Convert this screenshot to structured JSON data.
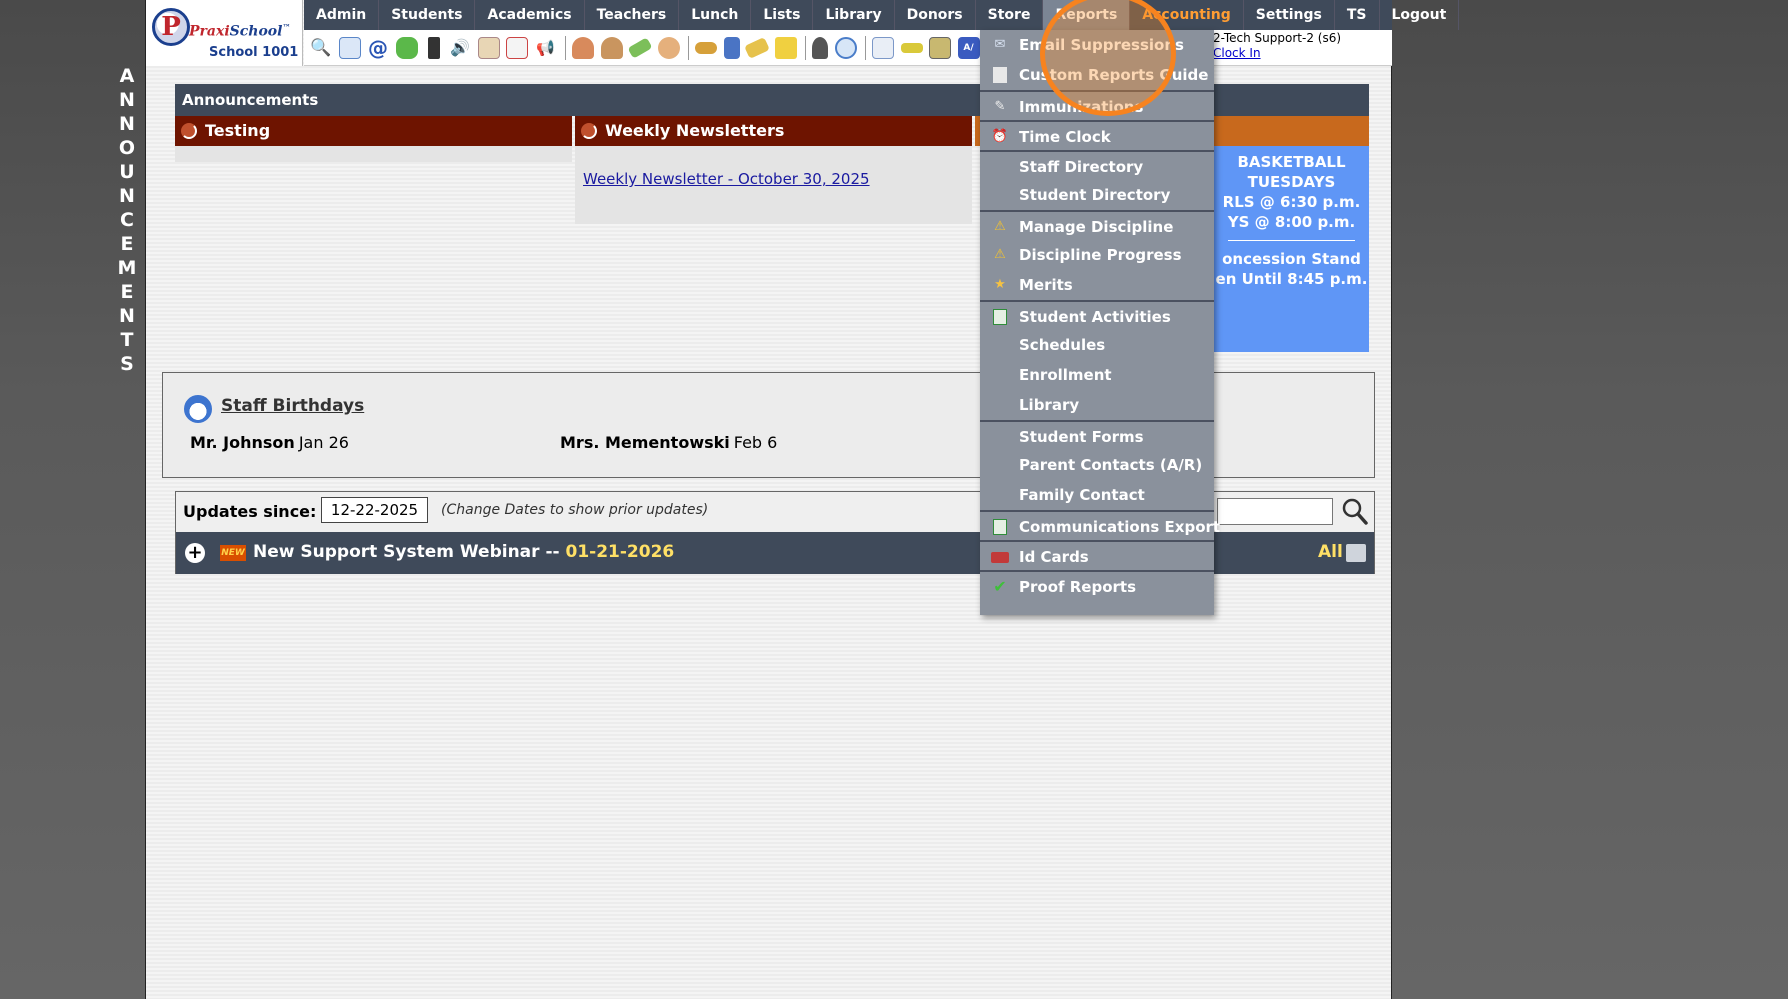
{
  "vertical_label": [
    "A",
    "N",
    "N",
    "O",
    "U",
    "N",
    "C",
    "E",
    "M",
    "E",
    "N",
    "T",
    "S"
  ],
  "logo": {
    "letter": "P",
    "brand_part1": "Praxi",
    "brand_part2": "School",
    "tm": "™",
    "school": "School 1001"
  },
  "nav": {
    "items": [
      "Admin",
      "Students",
      "Academics",
      "Teachers",
      "Lunch",
      "Lists",
      "Library",
      "Donors",
      "Store",
      "Reports",
      "Accounting",
      "Settings",
      "TS",
      "Logout"
    ]
  },
  "user": {
    "name": "2-Tech Support-2 (s6)",
    "clock_in": "Clock In"
  },
  "announcements": {
    "header": "Announcements",
    "columns": [
      {
        "title": "Testing",
        "color": "#6e1400"
      },
      {
        "title": "Weekly Newsletters",
        "color": "#6e1400",
        "link": "Weekly Newsletter - October 30, 2025"
      }
    ],
    "basketball": {
      "lines": [
        "BASKETBALL",
        "TUESDAYS",
        "RLS @ 6:30 p.m.",
        "YS  @ 8:00 p.m."
      ],
      "lines2": [
        "oncession Stand",
        "en Until 8:45 p.m."
      ]
    }
  },
  "birthdays": {
    "title": "Staff Birthdays",
    "entries": [
      {
        "name": "Mr. Johnson",
        "date": "Jan 26"
      },
      {
        "name": "Mrs. Mementowski",
        "date": "Feb 6"
      }
    ]
  },
  "updates": {
    "label": "Updates since:",
    "date": "12-22-2025",
    "note": "(Change Dates to show prior updates)",
    "item_badge": "NEW",
    "item_title": "New Support System Webinar -- ",
    "item_date": "01-21-2026",
    "all_label": "All"
  },
  "reports_menu": [
    {
      "label": "Email Suppressions",
      "icon": "envelope-icon",
      "sep": false
    },
    {
      "label": "Custom Reports Guide",
      "icon": "document-icon",
      "sep": false
    },
    {
      "label": "Immunizations",
      "icon": "syringe-icon",
      "sep": true
    },
    {
      "label": "Time Clock",
      "icon": "alarm-clock-icon",
      "sep": true
    },
    {
      "label": "Staff Directory",
      "icon": "",
      "sep": true
    },
    {
      "label": "Student Directory",
      "icon": "",
      "sep": false
    },
    {
      "label": "Manage Discipline",
      "icon": "warning-icon",
      "sep": true
    },
    {
      "label": "Discipline Progress",
      "icon": "warning-icon",
      "sep": false
    },
    {
      "label": "Merits",
      "icon": "star-icon",
      "sep": false
    },
    {
      "label": "Student Activities",
      "icon": "spreadsheet-icon",
      "sep": true
    },
    {
      "label": "Schedules",
      "icon": "",
      "sep": false
    },
    {
      "label": "Enrollment",
      "icon": "",
      "sep": false
    },
    {
      "label": "Library",
      "icon": "",
      "sep": false
    },
    {
      "label": "Student Forms",
      "icon": "",
      "sep": true
    },
    {
      "label": "Parent Contacts (A/R)",
      "icon": "",
      "sep": false
    },
    {
      "label": "Family Contact",
      "icon": "",
      "sep": false
    },
    {
      "label": "Communications Export",
      "icon": "spreadsheet-icon",
      "sep": true
    },
    {
      "label": "Id Cards",
      "icon": "id-card-icon",
      "sep": true
    },
    {
      "label": "Proof Reports",
      "icon": "checkmark-icon",
      "sep": true
    }
  ],
  "colors": {
    "nav_bg": "#3f4a5a",
    "menu_bg": "#8a919c",
    "accent": "#f7831f",
    "basket_bg": "#5f96f6"
  }
}
